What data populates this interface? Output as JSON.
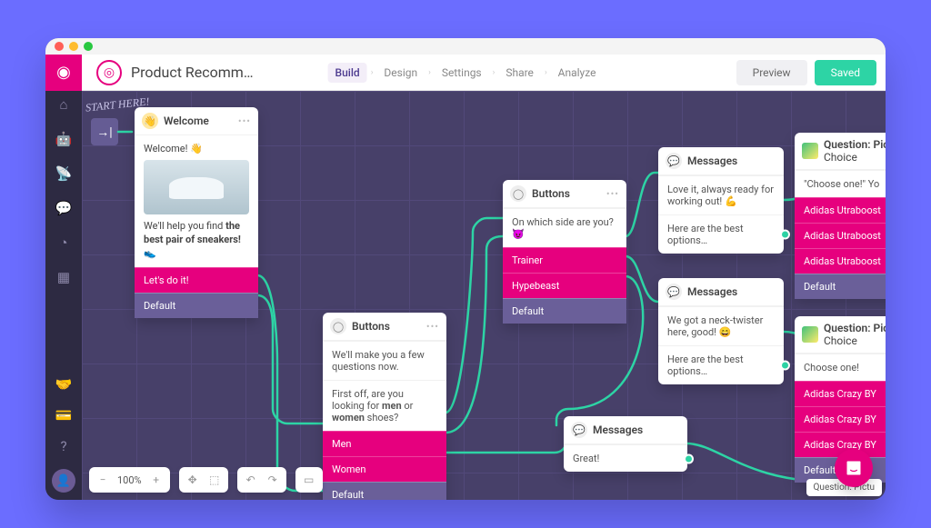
{
  "header": {
    "flow_name": "Product Recomm…",
    "tabs": [
      "Build",
      "Design",
      "Settings",
      "Share",
      "Analyze"
    ],
    "active_tab": "Build",
    "preview": "Preview",
    "saved": "Saved"
  },
  "sidebar": {
    "icons": [
      "home",
      "bot",
      "broadcast",
      "chat",
      "analytics",
      "apps"
    ],
    "bottom_icons": [
      "handshake",
      "card",
      "help"
    ]
  },
  "canvas": {
    "start_label": "START HERE!",
    "zoom": "100%",
    "peek_label": "Question: Pictu"
  },
  "nodes": {
    "welcome": {
      "title": "Welcome",
      "line1": "Welcome! 👋",
      "line2_a": "We'll help you find ",
      "line2_b": "the best pair of sneakers!",
      "line2_c": " 👟",
      "options": [
        "Let's do it!",
        "Default"
      ]
    },
    "buttons1": {
      "title": "Buttons",
      "line1": "We'll make you a few questions now.",
      "line2_a": "First off, are you looking for ",
      "line2_b": "men",
      "line2_c": " or ",
      "line2_d": "women",
      "line2_e": " shoes?",
      "options": [
        "Men",
        "Women",
        "Default"
      ]
    },
    "buttons2": {
      "title": "Buttons",
      "line1": "On which side are you? 😈",
      "options": [
        "Trainer",
        "Hypebeast",
        "Default"
      ]
    },
    "messages1": {
      "title": "Messages",
      "line1": "Love it, always ready for working out! 💪",
      "line2": "Here are the best options…"
    },
    "messages2": {
      "title": "Messages",
      "line1": "We got a neck-twister here, good! 😄",
      "line2": "Here are the best options…"
    },
    "messages3": {
      "title": "Messages",
      "line1": "Great!"
    },
    "q1": {
      "title": "Question: Pictur",
      "subtitle": "Choice",
      "prompt": "\"Choose one!\" Yo",
      "options": [
        "Adidas Utraboost",
        "Adidas Utraboost",
        "Adidas Utraboost",
        "Default"
      ]
    },
    "q2": {
      "title": "Question: Pictu",
      "subtitle": "Choice",
      "prompt": "Choose one!",
      "options": [
        "Adidas Crazy BY",
        "Adidas Crazy BY",
        "Adidas Crazy BY",
        "Default"
      ]
    }
  }
}
